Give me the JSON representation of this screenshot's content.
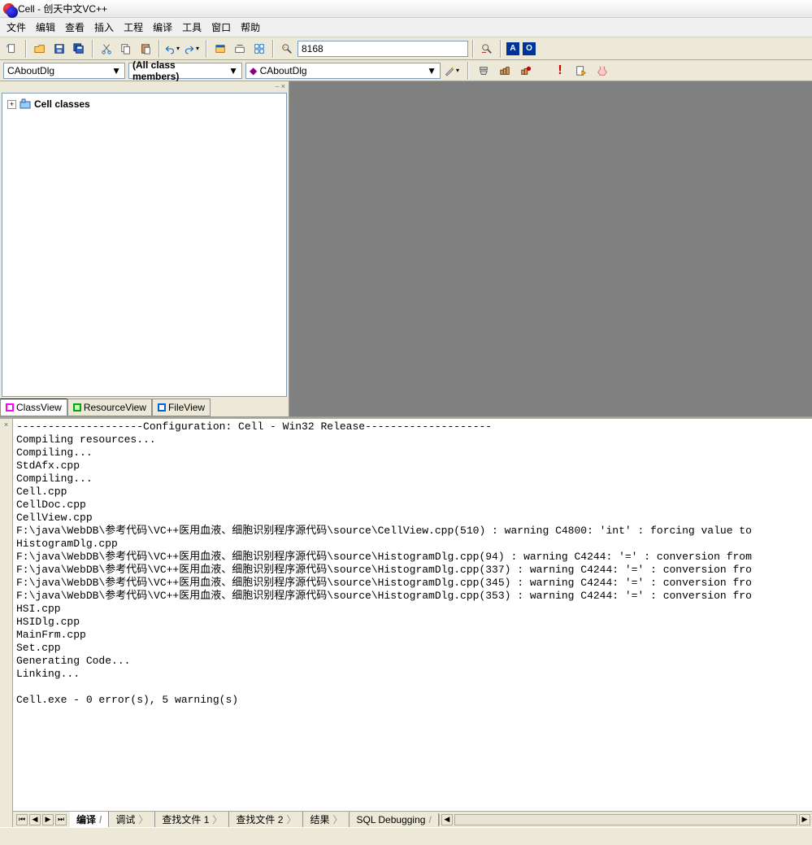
{
  "title": "Cell - 创天中文VC++",
  "menu": [
    "文件",
    "编辑",
    "查看",
    "插入",
    "工程",
    "编译",
    "工具",
    "窗口",
    "帮助"
  ],
  "toolbar1": {
    "input_value": "8168"
  },
  "toolbar2": {
    "combo1": "CAboutDlg",
    "combo2": "(All class members)",
    "combo3": "CAboutDlg"
  },
  "tree": {
    "root": "Cell classes"
  },
  "left_tabs": [
    "ClassView",
    "ResourceView",
    "FileView"
  ],
  "output_lines": [
    "--------------------Configuration: Cell - Win32 Release--------------------",
    "Compiling resources...",
    "Compiling...",
    "StdAfx.cpp",
    "Compiling...",
    "Cell.cpp",
    "CellDoc.cpp",
    "CellView.cpp",
    "F:\\java\\WebDB\\参考代码\\VC++医用血液、细胞识别程序源代码\\source\\CellView.cpp(510) : warning C4800: 'int' : forcing value to ",
    "HistogramDlg.cpp",
    "F:\\java\\WebDB\\参考代码\\VC++医用血液、细胞识别程序源代码\\source\\HistogramDlg.cpp(94) : warning C4244: '=' : conversion from",
    "F:\\java\\WebDB\\参考代码\\VC++医用血液、细胞识别程序源代码\\source\\HistogramDlg.cpp(337) : warning C4244: '=' : conversion fro",
    "F:\\java\\WebDB\\参考代码\\VC++医用血液、细胞识别程序源代码\\source\\HistogramDlg.cpp(345) : warning C4244: '=' : conversion fro",
    "F:\\java\\WebDB\\参考代码\\VC++医用血液、细胞识别程序源代码\\source\\HistogramDlg.cpp(353) : warning C4244: '=' : conversion fro",
    "HSI.cpp",
    "HSIDlg.cpp",
    "MainFrm.cpp",
    "Set.cpp",
    "Generating Code...",
    "Linking...",
    "",
    "Cell.exe - 0 error(s), 5 warning(s)"
  ],
  "output_tabs": [
    "编译",
    "调试",
    "查找文件 1",
    "查找文件 2",
    "结果",
    "SQL Debugging"
  ]
}
